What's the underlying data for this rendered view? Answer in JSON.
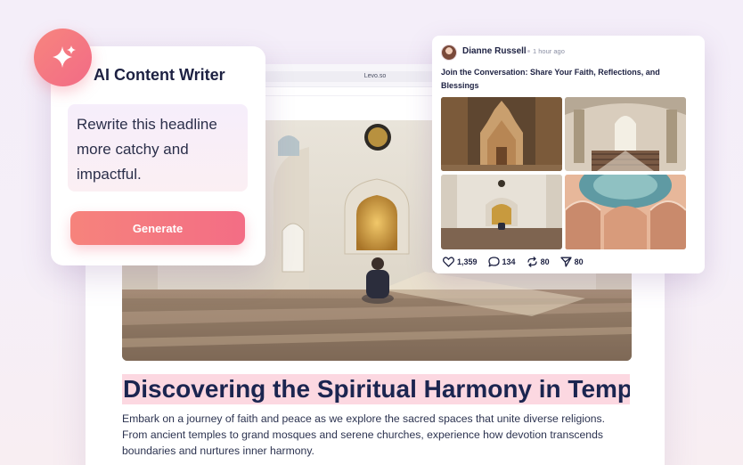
{
  "browser": {
    "url": "Levo.so"
  },
  "article": {
    "title": "Discovering the Spiritual Harmony in Temp",
    "body": "Embark on a journey of faith and peace as we explore the sacred spaces that unite diverse religions. From ancient temples to grand mosques and serene churches, experience how devotion transcends boundaries and nurtures inner harmony.",
    "hero_icon": "mosque-interior-image"
  },
  "ai_writer": {
    "title": "AI Content Writer",
    "icon": "sparkle-icon",
    "prompt": "Rewrite this headline more catchy and impactful.",
    "button_label": "Generate"
  },
  "post": {
    "author": "Dianne Russell",
    "time": "1 hour ago",
    "text": "Join the Conversation: Share Your Faith, Reflections, and Blessings",
    "images": [
      "temple-image",
      "church-image",
      "mosque-image",
      "dome-image"
    ],
    "stats": {
      "likes": "1,359",
      "comments": "134",
      "reposts": "80",
      "shares": "80"
    }
  },
  "colors": {
    "accent_start": "#f6837c",
    "accent_end": "#f36d85",
    "title_highlight": "#fcd8e1",
    "text_dark": "#1d2142"
  }
}
